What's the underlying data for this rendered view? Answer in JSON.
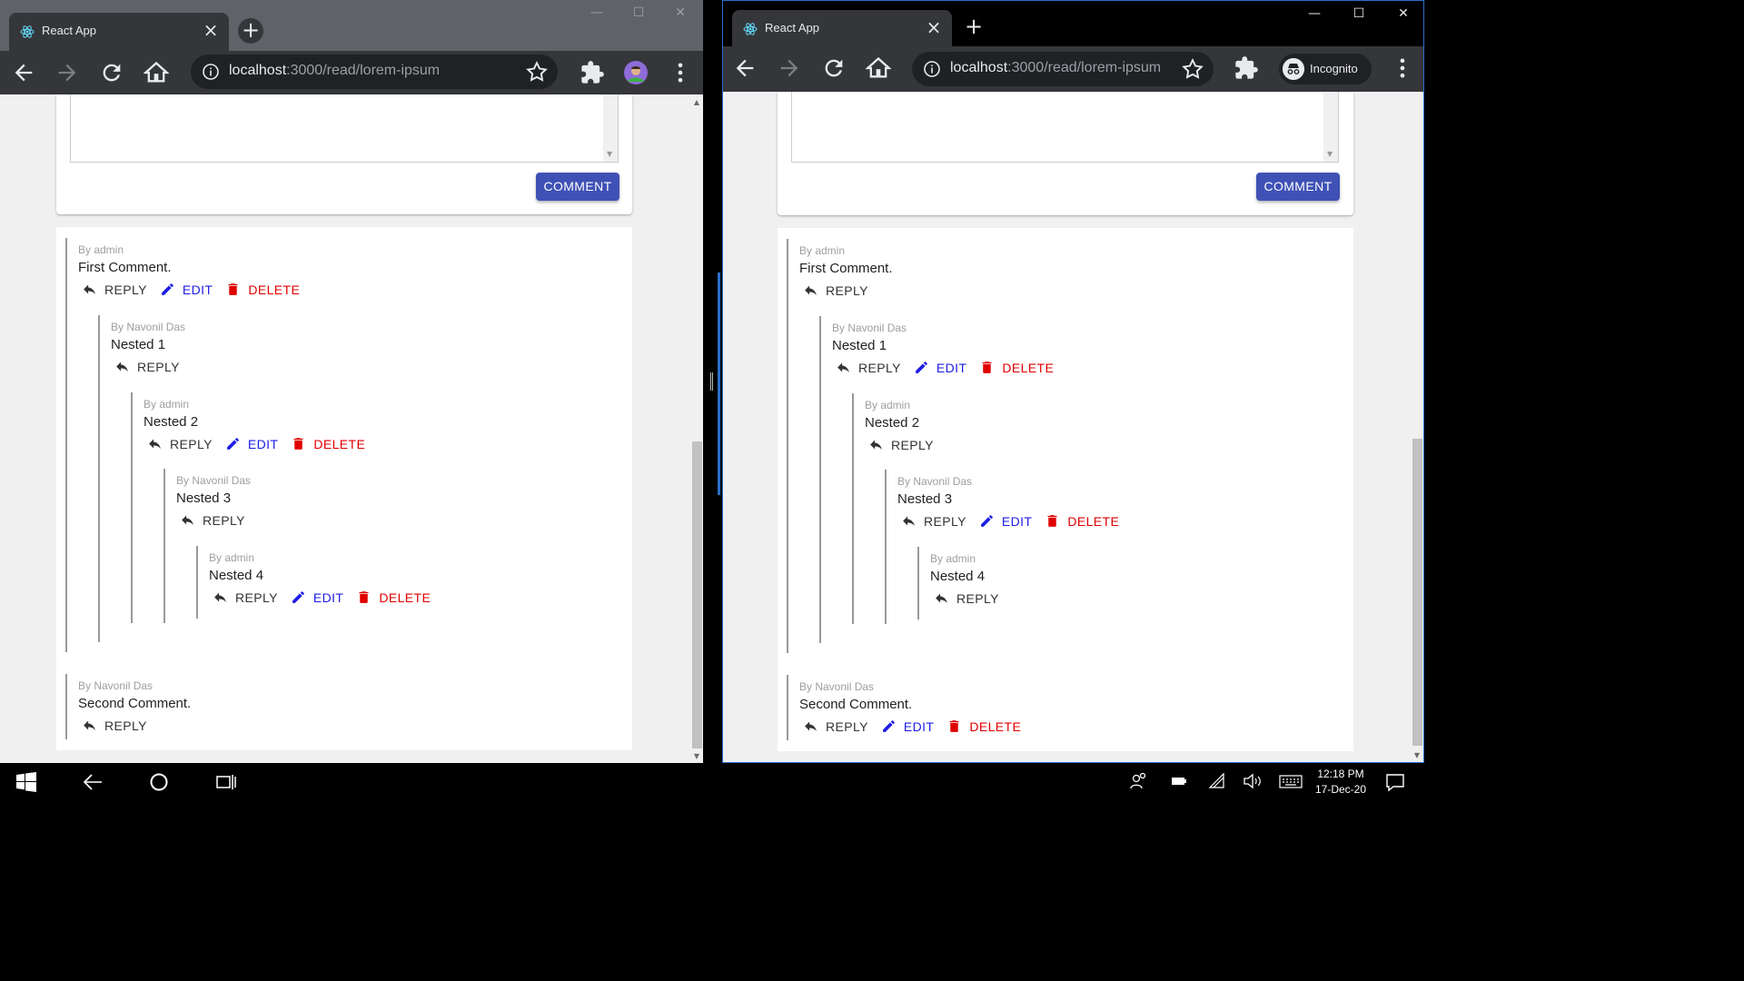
{
  "browser_left": {
    "tab_title": "React App",
    "url_host": "localhost",
    "url_path": ":3000/read/lorem-ipsum"
  },
  "browser_right": {
    "tab_title": "React App",
    "url_host": "localhost",
    "url_path": ":3000/read/lorem-ipsum",
    "incognito_label": "Incognito"
  },
  "comment_button": "COMMENT",
  "actions": {
    "reply": "REPLY",
    "edit": "EDIT",
    "delete": "DELETE"
  },
  "left_comments": [
    {
      "author": "By admin",
      "text": "First Comment.",
      "can_edit": true
    },
    {
      "author": "By Navonil Das",
      "text": "Nested 1",
      "can_edit": false
    },
    {
      "author": "By admin",
      "text": "Nested 2",
      "can_edit": true
    },
    {
      "author": "By Navonil Das",
      "text": "Nested 3",
      "can_edit": false
    },
    {
      "author": "By admin",
      "text": "Nested 4",
      "can_edit": true
    },
    {
      "author": "By Navonil Das",
      "text": "Second Comment.",
      "can_edit": false
    }
  ],
  "right_comments": [
    {
      "author": "By admin",
      "text": "First Comment.",
      "can_edit": false
    },
    {
      "author": "By Navonil Das",
      "text": "Nested 1",
      "can_edit": true
    },
    {
      "author": "By admin",
      "text": "Nested 2",
      "can_edit": false
    },
    {
      "author": "By Navonil Das",
      "text": "Nested 3",
      "can_edit": true
    },
    {
      "author": "By admin",
      "text": "Nested 4",
      "can_edit": false
    },
    {
      "author": "By Navonil Das",
      "text": "Second Comment.",
      "can_edit": true
    }
  ],
  "taskbar": {
    "time": "12:18 PM",
    "date": "17-Dec-20"
  }
}
